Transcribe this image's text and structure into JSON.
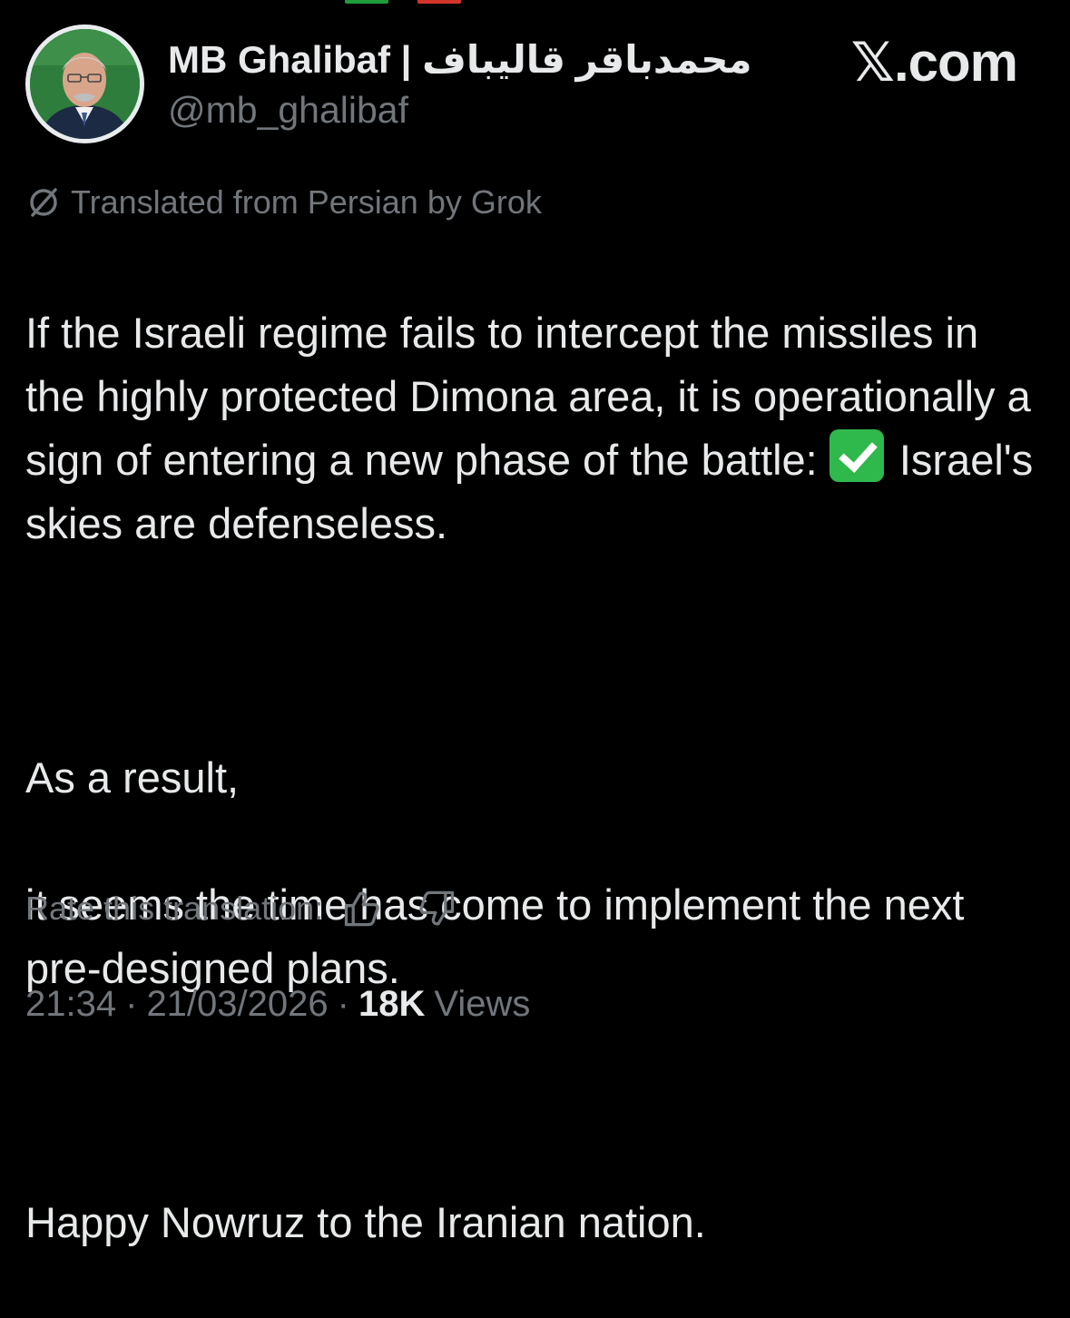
{
  "colors": {
    "background": "#000000",
    "text_primary": "#e7e9ea",
    "text_secondary": "#71767b",
    "check_green": "#2fb84b",
    "strip_green": "#1f9d3a",
    "strip_red": "#d4352b"
  },
  "header": {
    "display_name": "MB Ghalibaf | محمدباقر قالیباف",
    "handle": "@mb_ghalibaf",
    "watermark": "𝕏.com",
    "avatar_icon": "profile-photo"
  },
  "translation_notice": {
    "icon": "grok-icon",
    "text": "Translated from Persian by Grok"
  },
  "tweet": {
    "para1_part1": "If the Israeli regime fails to intercept the missiles in the highly protected Dimona area, it is operationally a sign of entering a new phase of the battle: ",
    "para1_emoji": "check-mark-button-emoji",
    "para1_part2": " Israel's skies are defenseless.",
    "para2_line1": "As a result,",
    "para2_line2": "it seems the time has come to implement the next pre-designed plans.",
    "para3": "Happy Nowruz to the Iranian nation."
  },
  "rating": {
    "label": "Rate this translation:",
    "up_icon": "thumbs-up-icon",
    "down_icon": "thumbs-down-icon"
  },
  "meta": {
    "time": "21:34",
    "date": "21/03/2026",
    "separator": "·",
    "views_count": "18K",
    "views_label": "Views"
  }
}
